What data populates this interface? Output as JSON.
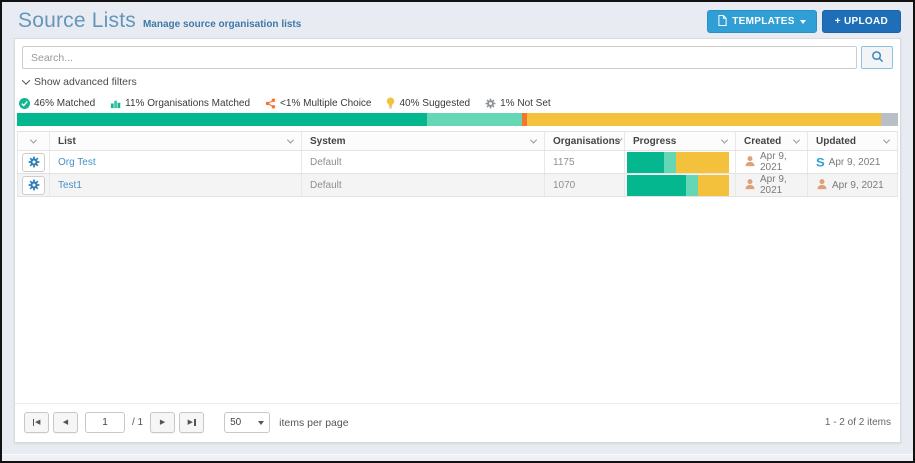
{
  "header": {
    "title": "Source Lists",
    "subtitle": "Manage source organisation lists",
    "templates_label": "TEMPLATES",
    "upload_label": "+ UPLOAD"
  },
  "search": {
    "placeholder": "Search..."
  },
  "filters": {
    "toggle_label": "Show advanced filters"
  },
  "legend": {
    "items": [
      {
        "icon": "check-circle-icon",
        "label": "46% Matched",
        "color": "#10b791"
      },
      {
        "icon": "bar-chart-icon",
        "label": "11% Organisations Matched",
        "color": "#10b791"
      },
      {
        "icon": "share-icon",
        "label": "<1% Multiple Choice",
        "color": "#f4752c"
      },
      {
        "icon": "lightbulb-icon",
        "label": "40% Suggested",
        "color": "#f3c13c"
      },
      {
        "icon": "gear-icon",
        "label": "1% Not Set",
        "color": "#8d9299"
      }
    ]
  },
  "overall_progress": {
    "segments": [
      {
        "name": "matched",
        "percent": 46.5,
        "color": "#05b78e"
      },
      {
        "name": "organisations-matched",
        "percent": 10.8,
        "color": "#66d7b5"
      },
      {
        "name": "multiple-choice",
        "percent": 0.6,
        "color": "#f4752c"
      },
      {
        "name": "suggested",
        "percent": 40.2,
        "color": "#f3c13c"
      },
      {
        "name": "not-set",
        "percent": 1.9,
        "color": "#b9bfc7"
      }
    ]
  },
  "table": {
    "headers": {
      "list": "List",
      "system": "System",
      "organisations": "Organisations",
      "progress": "Progress",
      "created": "Created",
      "updated": "Updated"
    },
    "rows": [
      {
        "list": "Org Test",
        "system": "Default",
        "organisations": "1175",
        "progress": {
          "segments": [
            {
              "name": "matched",
              "percent": 36,
              "color": "#05b78e"
            },
            {
              "name": "organisations-matched",
              "percent": 12,
              "color": "#66d7b5"
            },
            {
              "name": "suggested",
              "percent": 52,
              "color": "#f3c13c"
            }
          ]
        },
        "created_date": "Apr 9, 2021",
        "updated_date": "Apr 9, 2021"
      },
      {
        "list": "Test1",
        "system": "Default",
        "organisations": "1070",
        "progress": {
          "segments": [
            {
              "name": "matched",
              "percent": 58,
              "color": "#05b78e"
            },
            {
              "name": "organisations-matched",
              "percent": 12,
              "color": "#66d7b5"
            },
            {
              "name": "suggested",
              "percent": 30,
              "color": "#f3c13c"
            }
          ]
        },
        "created_date": "Apr 9, 2021",
        "updated_date": "Apr 9, 2021"
      }
    ]
  },
  "icons": {
    "s_logo_glyph": "S"
  },
  "pagination": {
    "page_value": "1",
    "page_total": "/ 1",
    "page_size": "50",
    "page_size_label": "items per page",
    "range_label": "1 - 2 of 2 items"
  }
}
